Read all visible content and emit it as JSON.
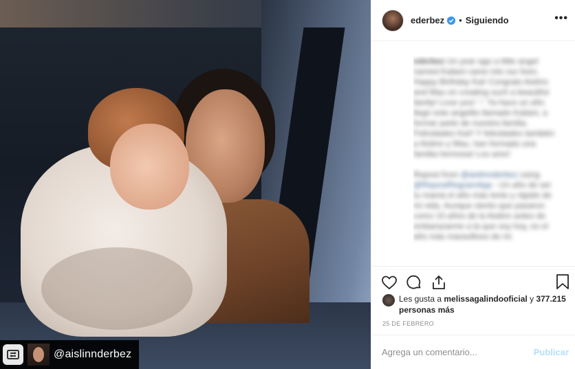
{
  "post": {
    "tagged_user": "@aislinnderbez"
  },
  "header": {
    "username": "ederbez",
    "separator": "•",
    "follow_status": "Siguiendo",
    "more_label": "•••",
    "verified_icon": "verified-badge-icon"
  },
  "caption": {
    "username": "ederbez",
    "text": "Un year ago a little angel named Kailani came into our lives. Happy Birthday Kai! Congrats Aislinn and Mau on creating such a beautiful family! Love you! ♡ Ya hace un año llegó este angelito llamado Kailani, a formar parte de nuestra familia. Felicidades Kai!! Y felicidades también a Aislinn y Mau, han formado una familia hermosa! Los amo!",
    "repost_line": "Repost from",
    "mention_1": "@aislinnderbez",
    "mention_1_suffix": "using",
    "mention_2": "@RepostRegramApp",
    "text_2": "- Un año de ser tu mamá el año más lento y rápido de mi vida. Aunque siento que pasaron como 10 años de la Aislinn antes de embarazarme a la que soy hoy, es el año más maravilloso de mi"
  },
  "likes": {
    "prefix": "Les gusta a",
    "liker": "melissagalindooficial",
    "joiner": "y",
    "count": "377.215 personas más"
  },
  "date": "25 DE FEBRERO",
  "comment": {
    "placeholder": "Agrega un comentario...",
    "publish_label": "Publicar"
  },
  "colors": {
    "accent_disabled": "#b2dffc",
    "verified": "#3897f0",
    "secondary_text": "#8e8e8e"
  }
}
